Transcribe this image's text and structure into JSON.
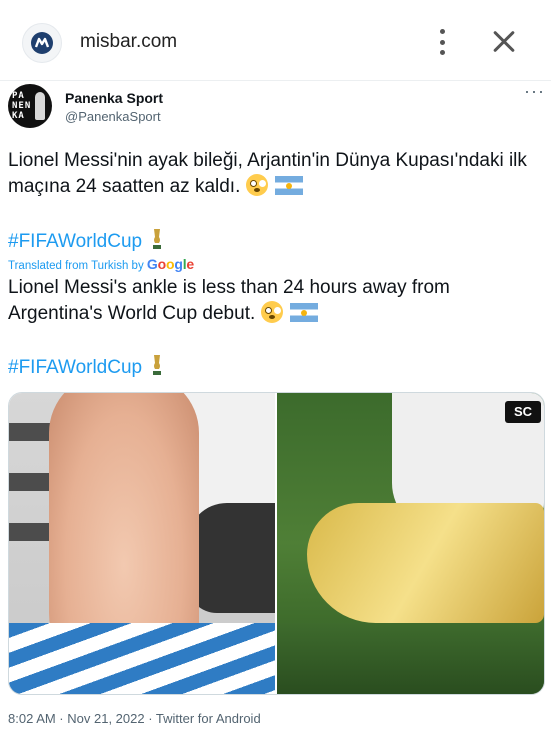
{
  "browser": {
    "domain": "misbar.com",
    "icons": {
      "logo": "misbar-logo-icon",
      "more": "vertical-ellipsis-icon",
      "close": "close-icon"
    }
  },
  "tweet": {
    "author_name": "Panenka Sport",
    "author_handle": "@PanenkaSport",
    "avatar_letters": "PA NEN KA",
    "original_text": "Lionel Messi'nin ayak bileği, Arjantin'in Dünya Kupası'ndaki ilk maçına 24 saatten az kaldı.",
    "original_hashtag": "#FIFAWorldCup",
    "translated_prefix": "Translated from Turkish by",
    "translated_brand": "Google",
    "translated_text": "Lionel Messi's ankle is less than 24 hours away from Argentina's World Cup debut.",
    "translated_hashtag": "#FIFAWorldCup",
    "media": {
      "right_overlay": "SC"
    },
    "timestamp": "8:02 AM · Nov 21, 2022 · Twitter for Android"
  },
  "colors": {
    "link": "#1d9bf0",
    "secondary_text": "#536471",
    "text": "#0f1419"
  }
}
